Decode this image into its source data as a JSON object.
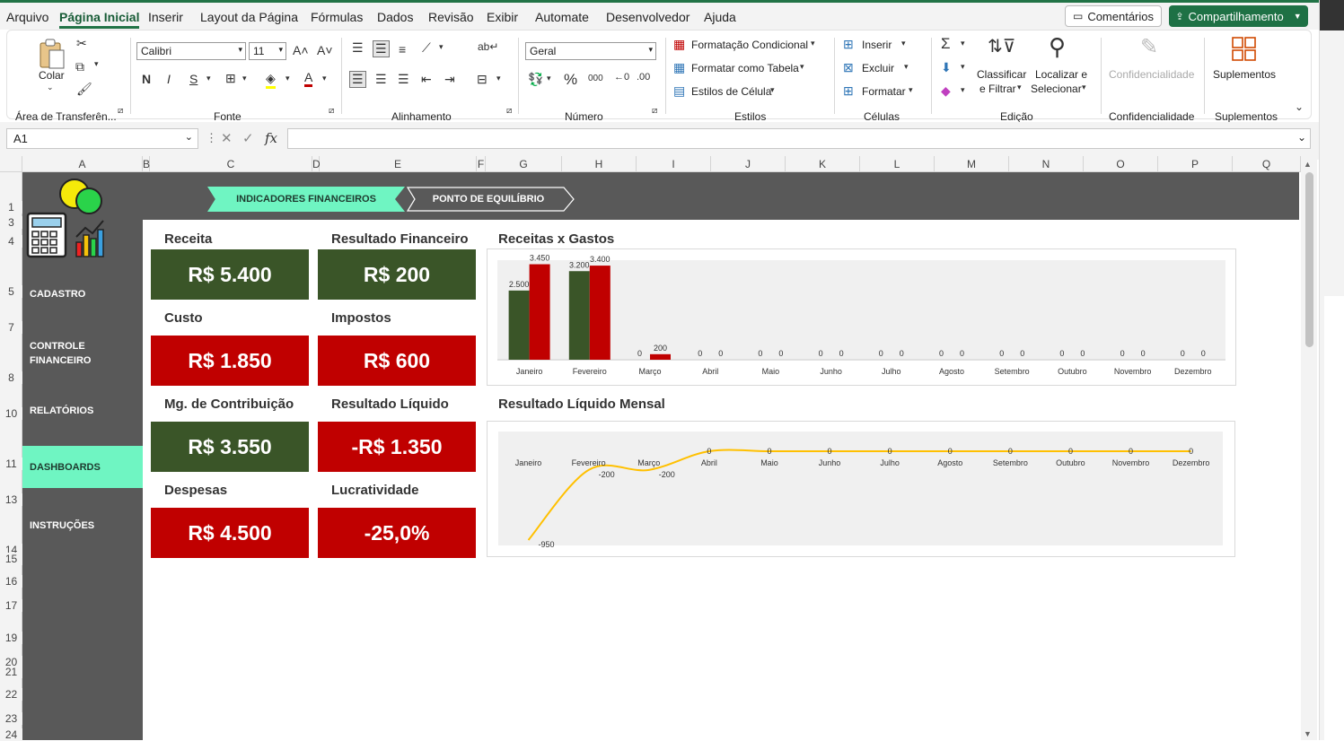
{
  "menu": {
    "items": [
      "Arquivo",
      "Página Inicial",
      "Inserir",
      "Layout da Página",
      "Fórmulas",
      "Dados",
      "Revisão",
      "Exibir",
      "Automate",
      "Desenvolvedor",
      "Ajuda"
    ],
    "comments": "Comentários",
    "share": "Compartilhamento"
  },
  "ribbon": {
    "paste": "Colar",
    "clipboard_group": "Área de Transferên...",
    "font_name": "Calibri",
    "font_size": "11",
    "font_group": "Fonte",
    "align_group": "Alinhamento",
    "number_format": "Geral",
    "number_group": "Número",
    "cond_format": "Formatação Condicional",
    "format_table": "Formatar como Tabela",
    "cell_styles": "Estilos de Célula",
    "styles_group": "Estilos",
    "insert": "Inserir",
    "delete": "Excluir",
    "format": "Formatar",
    "cells_group": "Células",
    "sort_filter_1": "Classificar",
    "sort_filter_2": "e Filtrar",
    "find_select_1": "Localizar e",
    "find_select_2": "Selecionar",
    "editing_group": "Edição",
    "sensitivity": "Confidencialidade",
    "sensitivity_group": "Confidencialidade",
    "addins": "Suplementos",
    "addins_group": "Suplementos"
  },
  "formula_bar": {
    "namebox": "A1",
    "formula": ""
  },
  "columns": [
    "A",
    "B",
    "C",
    "D",
    "E",
    "F",
    "G",
    "H",
    "I",
    "J",
    "K",
    "L",
    "M",
    "N",
    "O",
    "P",
    "Q"
  ],
  "rows": [
    "1",
    "3",
    "4",
    "5",
    "7",
    "8",
    "10",
    "11",
    "13",
    "14",
    "15",
    "16",
    "17",
    "19",
    "20",
    "21",
    "22",
    "23",
    "24"
  ],
  "dashboard": {
    "tabs": [
      "INDICADORES FINANCEIROS",
      "PONTO DE EQUILÍBRIO"
    ],
    "nav": [
      "CADASTRO",
      "CONTROLE FINANCEIRO",
      "RELATÓRIOS",
      "DASHBOARDS",
      "INSTRUÇÕES"
    ],
    "kpis": [
      {
        "label": "Receita",
        "value": "R$ 5.400",
        "color": "#3a5528"
      },
      {
        "label": "Resultado Financeiro",
        "value": "R$ 200",
        "color": "#3a5528"
      },
      {
        "label": "Custo",
        "value": "R$ 1.850",
        "color": "#c00000"
      },
      {
        "label": "Impostos",
        "value": "R$ 600",
        "color": "#c00000"
      },
      {
        "label": "Mg. de Contribuição",
        "value": "R$ 3.550",
        "color": "#3a5528"
      },
      {
        "label": "Resultado Líquido",
        "value": "-R$ 1.350",
        "color": "#c00000"
      },
      {
        "label": "Despesas",
        "value": "R$ 4.500",
        "color": "#c00000"
      },
      {
        "label": "Lucratividade",
        "value": "-25,0%",
        "color": "#c00000"
      }
    ]
  },
  "chart_data": [
    {
      "type": "bar",
      "title": "Receitas x Gastos",
      "categories": [
        "Janeiro",
        "Fevereiro",
        "Março",
        "Abril",
        "Maio",
        "Junho",
        "Julho",
        "Agosto",
        "Setembro",
        "Outubro",
        "Novembro",
        "Dezembro"
      ],
      "series": [
        {
          "values": [
            2500,
            3200,
            0,
            0,
            0,
            0,
            0,
            0,
            0,
            0,
            0,
            0
          ],
          "labels": [
            "2.500",
            "3.200",
            "0",
            "0",
            "0",
            "0",
            "0",
            "0",
            "0",
            "0",
            "0",
            "0"
          ],
          "color": "#3a5528"
        },
        {
          "values": [
            3450,
            3400,
            200,
            0,
            0,
            0,
            0,
            0,
            0,
            0,
            0,
            0
          ],
          "labels": [
            "3.450",
            "3.400",
            "200",
            "0",
            "0",
            "0",
            "0",
            "0",
            "0",
            "0",
            "0",
            "0"
          ],
          "color": "#c00000"
        }
      ],
      "ylim": [
        0,
        3500
      ]
    },
    {
      "type": "line",
      "title": "Resultado Líquido Mensal",
      "categories": [
        "Janeiro",
        "Fevereiro",
        "Março",
        "Abril",
        "Maio",
        "Junho",
        "Julho",
        "Agosto",
        "Setembro",
        "Outubro",
        "Novembro",
        "Dezembro"
      ],
      "series": [
        {
          "values": [
            -950,
            -200,
            -200,
            0,
            0,
            0,
            0,
            0,
            0,
            0,
            0,
            0
          ],
          "labels": [
            "-950",
            "-200",
            "-200",
            "0",
            "0",
            "0",
            "0",
            "0",
            "0",
            "0",
            "0",
            "0"
          ],
          "color": "#ffc000"
        }
      ],
      "ylim": [
        -950,
        0
      ]
    }
  ]
}
